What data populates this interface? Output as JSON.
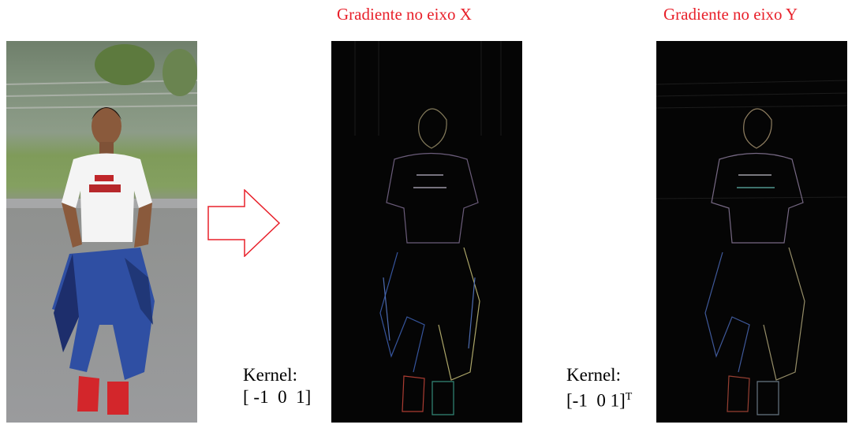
{
  "title_x": "Gradiente no eixo X",
  "title_y": "Gradiente no eixo Y",
  "kernel_x": {
    "label": "Kernel:",
    "matrix": "[ -1  0  1]"
  },
  "kernel_y": {
    "label": "Kernel:",
    "matrix": "[-1  0 1]",
    "superscript": "T"
  },
  "colors": {
    "title": "#e8202a",
    "arrow": "#e8202a",
    "panel_bg": "#050505"
  }
}
